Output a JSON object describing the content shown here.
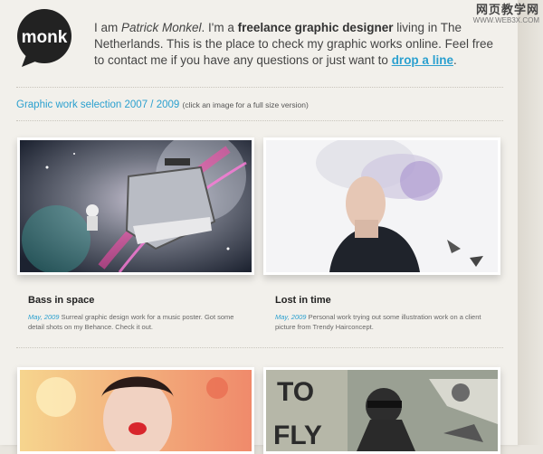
{
  "logo": {
    "text": "monk"
  },
  "intro": {
    "part1": "I am ",
    "name": "Patrick Monkel",
    "part2": ". I'm a ",
    "role": "freelance graphic designer",
    "part3": " living in The Netherlands. This is the place to check my graphic works online. Feel free to contact me if you have any questions or just want to ",
    "link": "drop a line",
    "part4": "."
  },
  "section": {
    "heading": "Graphic work selection 2007 / 2009",
    "note": "(click an image for a full size version)"
  },
  "cards": [
    {
      "title": "Bass in space",
      "date": "May, 2009",
      "description": "Surreal graphic design work for a music poster. Got some detail shots on my Behance. Check it out."
    },
    {
      "title": "Lost in time",
      "date": "May, 2009",
      "description": "Personal work trying out some illustration work on a client picture from Trendy Hairconcept."
    }
  ],
  "poster_text": {
    "to": "TO",
    "fly": "FLY"
  },
  "watermark": {
    "cn": "网页教学网",
    "url": "WWW.WEB3X.COM"
  },
  "colors": {
    "accent": "#2ba0cf",
    "page": "#f2f0eb",
    "text": "#444444"
  }
}
